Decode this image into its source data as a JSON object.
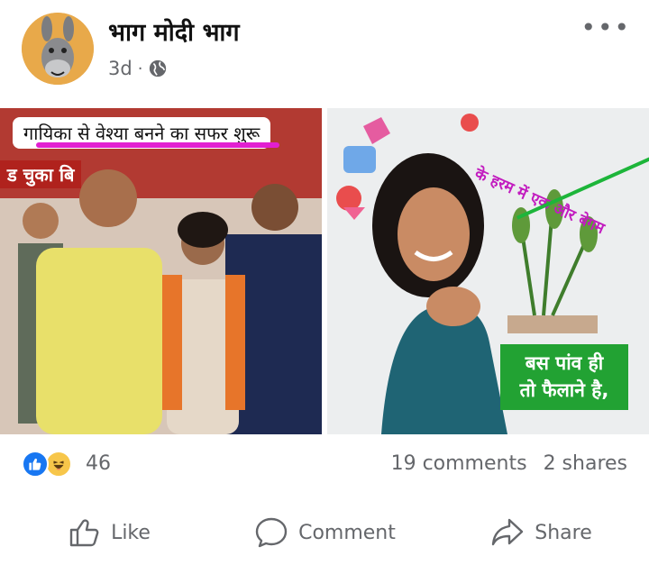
{
  "post": {
    "page_name": "भाग मोदी भाग",
    "time": "3d",
    "separator": "·",
    "privacy_icon": "globe-icon",
    "more_icon": "more-dots-icon"
  },
  "images": {
    "left": {
      "caption": "गायिका से वेश्या बनने का सफर शुरू",
      "banner_fragment": "ड चुका बि"
    },
    "right": {
      "overlay_text": "के हरम में एक और बेगम",
      "green_text_line1": "बस पांव ही",
      "green_text_line2": "तो फैलाने है,"
    }
  },
  "reactions": {
    "count": "46",
    "types": [
      "like",
      "haha"
    ]
  },
  "stats": {
    "comments": "19 comments",
    "shares": "2 shares"
  },
  "actions": {
    "like": "Like",
    "comment": "Comment",
    "share": "Share"
  },
  "colors": {
    "facebook_blue": "#1877f2",
    "caption_underline": "#e21fd1",
    "green_box": "#22a233",
    "overlay_text": "#c21cbf"
  }
}
